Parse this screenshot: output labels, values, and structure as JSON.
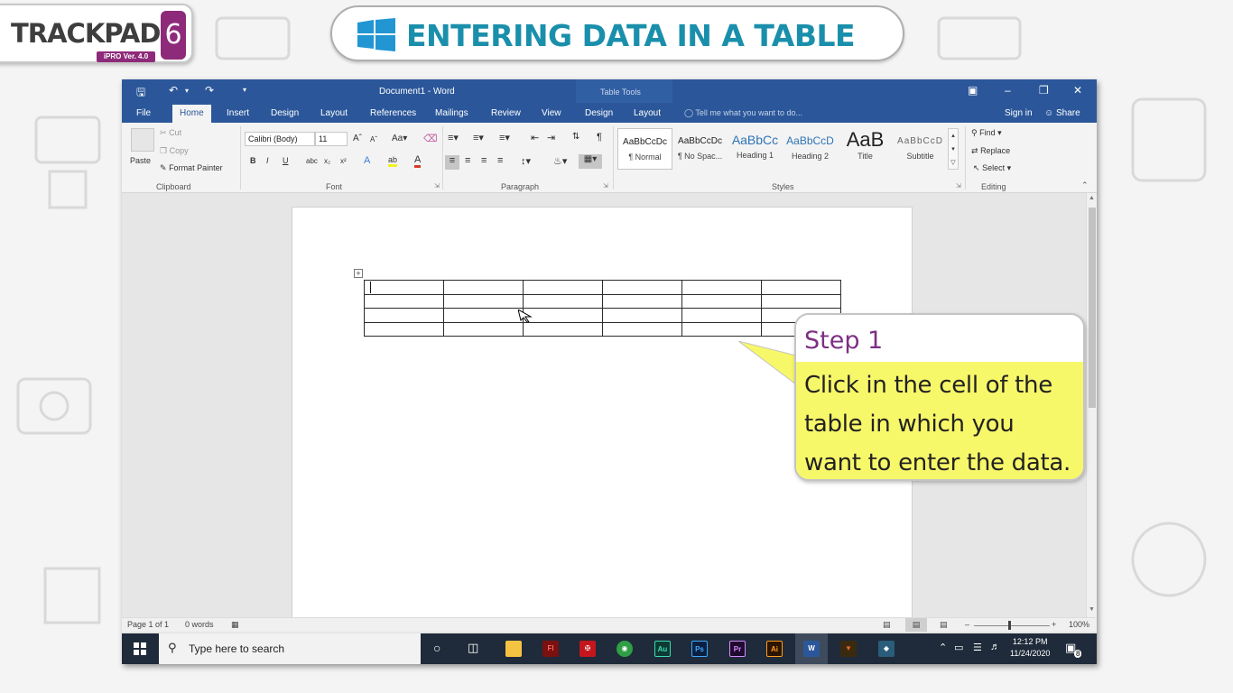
{
  "logo": {
    "text": "TRACKPAD",
    "badge": "6",
    "version": "iPRO Ver. 4.0"
  },
  "banner": {
    "title": "ENTERING DATA IN A TABLE",
    "icon": "windows-logo-icon"
  },
  "word": {
    "doc_title": "Document1 - Word",
    "context_tab_group": "Table Tools",
    "tabs": [
      "File",
      "Home",
      "Insert",
      "Design",
      "Layout",
      "References",
      "Mailings",
      "Review",
      "View",
      "Design",
      "Layout"
    ],
    "active_tab": "Home",
    "tell_me": "Tell me what you want to do...",
    "sign_in": "Sign in",
    "share": "Share",
    "clipboard": {
      "paste": "Paste",
      "cut": "Cut",
      "copy": "Copy",
      "format_painter": "Format Painter",
      "label": "Clipboard"
    },
    "font": {
      "name": "Calibri (Body)",
      "size": "11",
      "label": "Font"
    },
    "paragraph": {
      "label": "Paragraph"
    },
    "styles": {
      "label": "Styles",
      "items": [
        {
          "sample": "AaBbCcDc",
          "name": "¶ Normal"
        },
        {
          "sample": "AaBbCcDc",
          "name": "¶ No Spac..."
        },
        {
          "sample": "AaBbCc",
          "name": "Heading 1"
        },
        {
          "sample": "AaBbCcD",
          "name": "Heading 2"
        },
        {
          "sample": "AaB",
          "name": "Title"
        },
        {
          "sample": "AaBbCcD",
          "name": "Subtitle"
        }
      ]
    },
    "editing": {
      "find": "Find",
      "replace": "Replace",
      "select": "Select",
      "label": "Editing"
    },
    "table": {
      "rows": 4,
      "cols": 6
    },
    "status": {
      "page": "Page 1 of 1",
      "words": "0 words",
      "zoom": "100%"
    }
  },
  "taskbar": {
    "search_placeholder": "Type here to search",
    "time": "12:12 PM",
    "date": "11/24/2020",
    "notifications": "8"
  },
  "callout": {
    "title": "Step 1",
    "lines": [
      "Click in the cell of the",
      "table in which you",
      "want to enter the data."
    ]
  },
  "colors": {
    "word_blue": "#2b579a",
    "callout_yellow": "#f7f76a",
    "step_purple": "#7d2f83",
    "banner_teal": "#1a8fab",
    "logo_purple": "#8e2a7a"
  }
}
